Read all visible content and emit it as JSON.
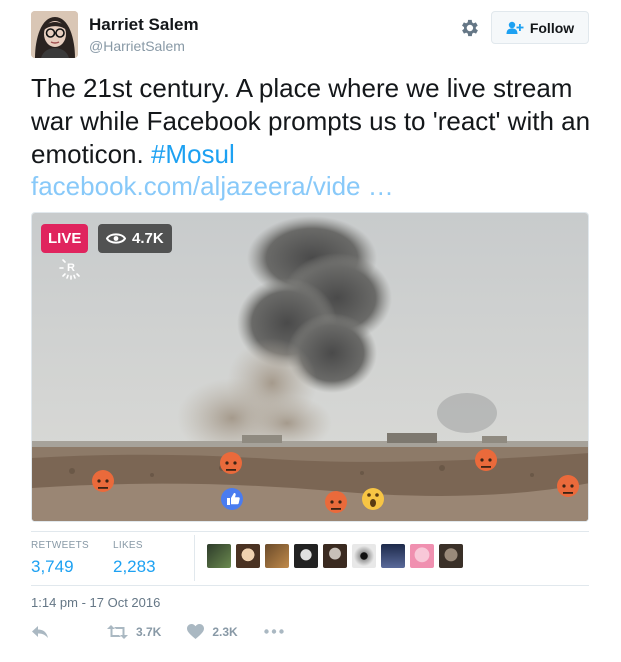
{
  "user": {
    "name": "Harriet Salem",
    "handle": "@HarrietSalem"
  },
  "follow_label": "Follow",
  "tweet": {
    "text": "The 21st century. A place where we live stream war while Facebook prompts us to 'react' with an emoticon.",
    "hashtag": "#Mosul",
    "link": "facebook.com/aljazeera/vide …"
  },
  "media": {
    "live_badge": "LIVE",
    "viewers": "4.7K",
    "reactions": [
      "angry",
      "angry",
      "angry",
      "angry",
      "angry",
      "like",
      "wow"
    ]
  },
  "stats": {
    "retweets_label": "RETWEETS",
    "retweets_value": "3,749",
    "likes_label": "LIKES",
    "likes_value": "2,283"
  },
  "timestamp": "1:14 pm - 17 Oct 2016",
  "actions": {
    "retweet_count": "3.7K",
    "like_count": "2.3K"
  },
  "colors": {
    "link": "#1da1f2",
    "live": "#e0245e"
  }
}
